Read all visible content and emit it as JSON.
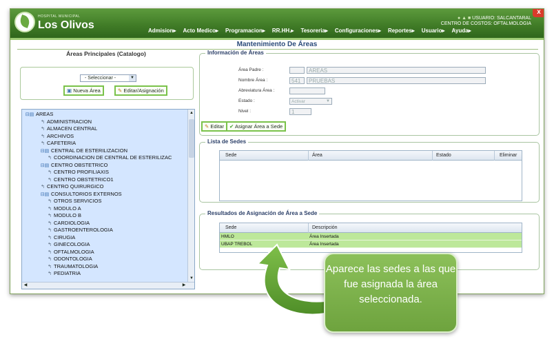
{
  "header": {
    "logo_small": "HOSPITAL MUNICIPAL",
    "logo_name": "Los Olivos",
    "user_line1": "USUARIO: SALCANTARAL",
    "user_line2": "CENTRO DE COSTOS: OFTALMOLOGIA",
    "close": "x"
  },
  "menu": [
    {
      "label": "Admision▸"
    },
    {
      "label": "Acto Medico▸"
    },
    {
      "label": "Programacion▸"
    },
    {
      "label": "RR.HH.▸"
    },
    {
      "label": "Tesoreria▸"
    },
    {
      "label": "Configuraciones▸"
    },
    {
      "label": "Reportes▸"
    },
    {
      "label": "Usuario▸"
    },
    {
      "label": "Ayuda▸"
    }
  ],
  "page_title": "Mantenimiento De Áreas",
  "left": {
    "title": "Áreas Principales (Catalogo)",
    "select_value": "- Seleccionar -",
    "nueva_area": "Nueva Área",
    "editar_asignacion": "Editar/Asignación",
    "tree": [
      {
        "label": "AREAS",
        "level": 0,
        "kind": "folder"
      },
      {
        "label": "ADMINISTRACION",
        "level": 1,
        "kind": "leaf"
      },
      {
        "label": "ALMACEN CENTRAL",
        "level": 1,
        "kind": "leaf"
      },
      {
        "label": "ARCHIVOS",
        "level": 1,
        "kind": "leaf"
      },
      {
        "label": "CAFETERIA",
        "level": 1,
        "kind": "leaf"
      },
      {
        "label": "CENTRAL DE ESTERILIZACION",
        "level": 1,
        "kind": "folder"
      },
      {
        "label": "COORDINACION DE CENTRAL DE ESTERILIZAC",
        "level": 2,
        "kind": "leaf"
      },
      {
        "label": "CENTRO OBSTETRICO",
        "level": 1,
        "kind": "folder"
      },
      {
        "label": "CENTRO PROFILIAXIS",
        "level": 2,
        "kind": "leaf"
      },
      {
        "label": "CENTRO OBSTETRICO1",
        "level": 2,
        "kind": "leaf"
      },
      {
        "label": "CENTRO QUIRURGICO",
        "level": 1,
        "kind": "leaf"
      },
      {
        "label": "CONSULTORIOS EXTERNOS",
        "level": 1,
        "kind": "folder"
      },
      {
        "label": "OTROS SERVICIOS",
        "level": 2,
        "kind": "leaf"
      },
      {
        "label": "MODULO A",
        "level": 2,
        "kind": "leaf"
      },
      {
        "label": "MODULO B",
        "level": 2,
        "kind": "leaf"
      },
      {
        "label": "CARDIOLOGIA",
        "level": 2,
        "kind": "leaf"
      },
      {
        "label": "GASTROENTEROLOGIA",
        "level": 2,
        "kind": "leaf"
      },
      {
        "label": "CIRUGIA",
        "level": 2,
        "kind": "leaf"
      },
      {
        "label": "GINECOLOGIA",
        "level": 2,
        "kind": "leaf"
      },
      {
        "label": "OFTALMOLOGIA",
        "level": 2,
        "kind": "leaf"
      },
      {
        "label": "ODONTOLOGIA",
        "level": 2,
        "kind": "leaf"
      },
      {
        "label": "TRAUMATOLOGIA",
        "level": 2,
        "kind": "leaf"
      },
      {
        "label": "PEDIATRIA",
        "level": 2,
        "kind": "leaf"
      }
    ]
  },
  "info": {
    "legend": "Información de Áreas",
    "area_padre_label": "Área Padre :",
    "area_padre_value": "AREAS",
    "nombre_label": "Nombre Área :",
    "nombre_code": "541",
    "nombre_value": "PRUEBAS",
    "abrev_label": "Abreviatura Área :",
    "estado_label": "Estado :",
    "estado_value": "Activar",
    "nivel_label": "Nivel :",
    "nivel_value": "1",
    "editar": "Editar",
    "asignar": "Asignar Área a Sede"
  },
  "sedes": {
    "legend": "Lista de Sedes",
    "headers": {
      "sede": "Sede",
      "area": "Área",
      "estado": "Estado",
      "eliminar": "Eliminar"
    }
  },
  "resultados": {
    "legend": "Resultados de Asignación de Área a Sede",
    "headers": {
      "sede": "Sede",
      "descripcion": "Descripción"
    },
    "rows": [
      {
        "sede": "HMLO",
        "descripcion": "Área Insertada"
      },
      {
        "sede": "UBAP TREBOL",
        "descripcion": "Área Insertada"
      }
    ]
  },
  "callout": {
    "text": "Aparece las sedes a las que fue asignada la área seleccionada."
  },
  "colors": {
    "brand_green": "#3f7a26",
    "row_green": "#bde89a",
    "callout": "#7db04a"
  }
}
